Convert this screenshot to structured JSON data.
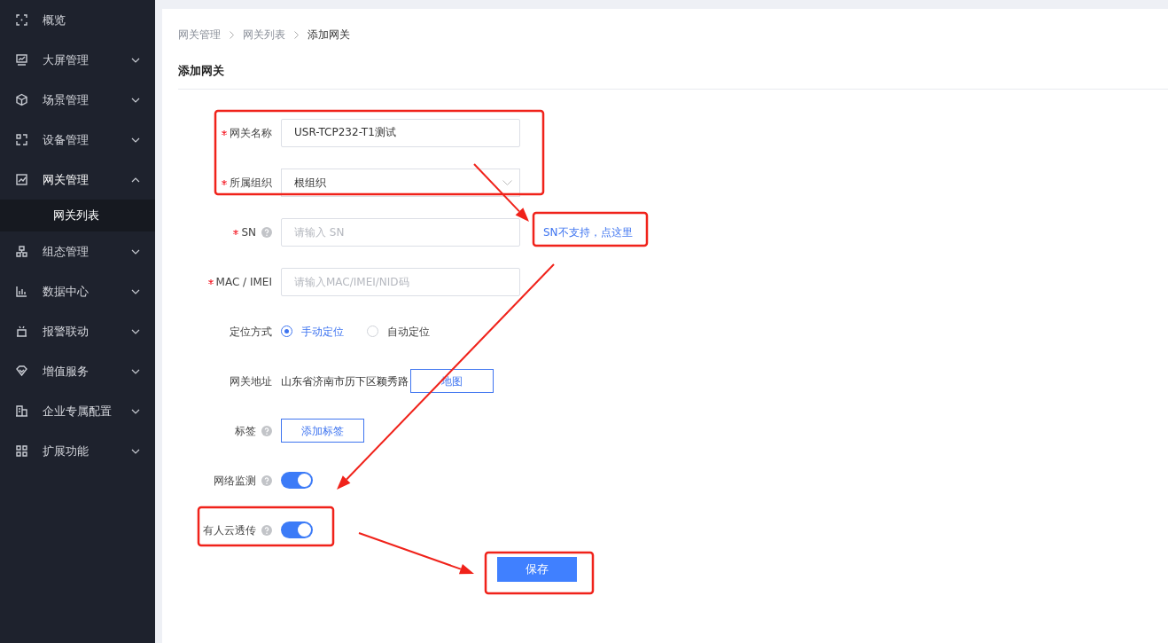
{
  "sidebar": {
    "items": [
      {
        "label": "概览",
        "kind": "link"
      },
      {
        "label": "大屏管理",
        "kind": "group",
        "expanded": false
      },
      {
        "label": "场景管理",
        "kind": "group",
        "expanded": false
      },
      {
        "label": "设备管理",
        "kind": "group",
        "expanded": false
      },
      {
        "label": "网关管理",
        "kind": "group",
        "expanded": true,
        "children": [
          {
            "label": "网关列表",
            "selected": true
          }
        ]
      },
      {
        "label": "组态管理",
        "kind": "group",
        "expanded": false
      },
      {
        "label": "数据中心",
        "kind": "group",
        "expanded": false
      },
      {
        "label": "报警联动",
        "kind": "group",
        "expanded": false
      },
      {
        "label": "增值服务",
        "kind": "group",
        "expanded": false
      },
      {
        "label": "企业专属配置",
        "kind": "group",
        "expanded": false
      },
      {
        "label": "扩展功能",
        "kind": "group",
        "expanded": false
      }
    ]
  },
  "breadcrumb": [
    "网关管理",
    "网关列表",
    "添加网关"
  ],
  "page_title": "添加网关",
  "form": {
    "fields": [
      {
        "kind": "text",
        "label": "网关名称",
        "required": true,
        "help": false,
        "value": "USR-TCP232-T1测试"
      },
      {
        "kind": "select",
        "label": "所属组织",
        "required": true,
        "help": false,
        "value": "根组织"
      },
      {
        "kind": "text",
        "label": "SN",
        "required": true,
        "help": true,
        "placeholder": "请输入 SN",
        "link": "SN不支持，点这里"
      },
      {
        "kind": "text",
        "label": "MAC / IMEI",
        "required": true,
        "help": false,
        "placeholder": "请输入MAC/IMEI/NID码"
      },
      {
        "kind": "radio",
        "label": "定位方式",
        "required": false,
        "help": false,
        "options": [
          {
            "label": "手动定位",
            "selected": true
          },
          {
            "label": "自动定位",
            "selected": false
          }
        ]
      },
      {
        "kind": "address",
        "label": "网关地址",
        "required": false,
        "help": false,
        "value": "山东省济南市历下区颖秀路",
        "button": "地图"
      },
      {
        "kind": "tags",
        "label": "标签",
        "required": false,
        "help": true,
        "button": "添加标签"
      },
      {
        "kind": "switch",
        "label": "网络监测",
        "required": false,
        "help": true,
        "on": true
      },
      {
        "kind": "switch",
        "label": "有人云透传",
        "required": false,
        "help": true,
        "on": true
      }
    ],
    "save_button": "保存"
  }
}
